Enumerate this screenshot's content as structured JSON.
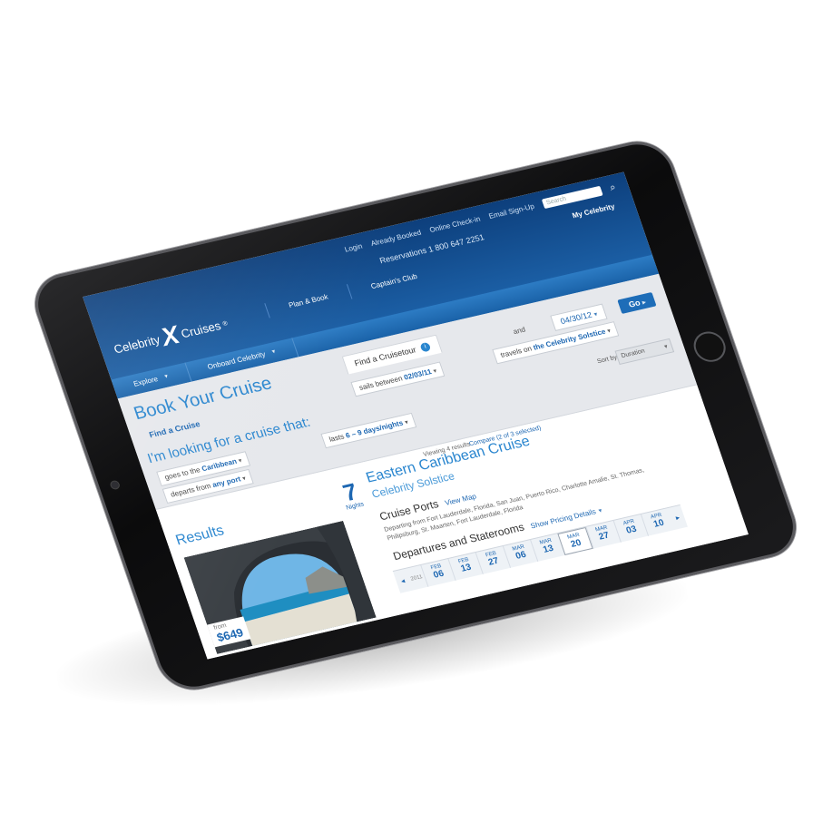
{
  "header": {
    "util_links": [
      "Login",
      "Already Booked",
      "Online Check-in",
      "Email Sign-Up"
    ],
    "search_placeholder": "Search",
    "reservations": "Reservations 1 800 647 2251",
    "my_celebrity": "My Celebrity",
    "logo": {
      "word1": "Celebrity",
      "mark": "X",
      "word2": "Cruises",
      "reg": "®"
    },
    "top_nav": [
      "Plan & Book",
      "Captain's Club"
    ],
    "main_nav": [
      "Explore",
      "Onboard Celebrity"
    ]
  },
  "book": {
    "title": "Book Your Cruise",
    "tab_find": "Find a Cruise",
    "tab_cruisetour": "Find a Cruisetour",
    "looking_for": "I'm looking for a cruise that:",
    "sails_between_label": "sails between",
    "start_date": "02/03/11",
    "and_label": "and",
    "end_date": "04/30/12",
    "goes_to_label": "goes to the",
    "destination": "Caribbean",
    "lasts_label": "lasts",
    "duration": "6 – 9 days/nights",
    "travels_on_label": "travels on",
    "ship": "the Celebrity Solstice",
    "departs_from_label": "departs from",
    "port": "any port",
    "go_button": "Go",
    "sort_by_label": "Sort by:",
    "sort_value": "Duration"
  },
  "results": {
    "title": "Results",
    "viewing": "Viewing 4 results",
    "compare": "Compare (2 of 3 selected)",
    "from_label": "from",
    "price": "$649",
    "nights": "7",
    "nights_label": "Nights",
    "cruise_name": "Eastern Caribbean Cruise",
    "ship_name": "Celebrity Solstice",
    "ports_heading": "Cruise Ports",
    "view_map": "View Map",
    "ports_list": "Departing from Fort Lauderdale, Florida, San Juan, Puerto Rico, Charlotte Amalie, St. Thomas, Philipsburg, St. Maarten, Fort Lauderdale, Florida",
    "departures_heading": "Departures and Staterooms",
    "show_pricing": "Show Pricing Details",
    "year": "2011",
    "dates": [
      {
        "month": "FEB",
        "day": "06"
      },
      {
        "month": "FEB",
        "day": "13"
      },
      {
        "month": "FEB",
        "day": "27"
      },
      {
        "month": "MAR",
        "day": "06"
      },
      {
        "month": "MAR",
        "day": "13"
      },
      {
        "month": "MAR",
        "day": "20"
      },
      {
        "month": "MAR",
        "day": "27"
      },
      {
        "month": "APR",
        "day": "03"
      },
      {
        "month": "APR",
        "day": "10"
      }
    ],
    "selected_index": 5
  }
}
